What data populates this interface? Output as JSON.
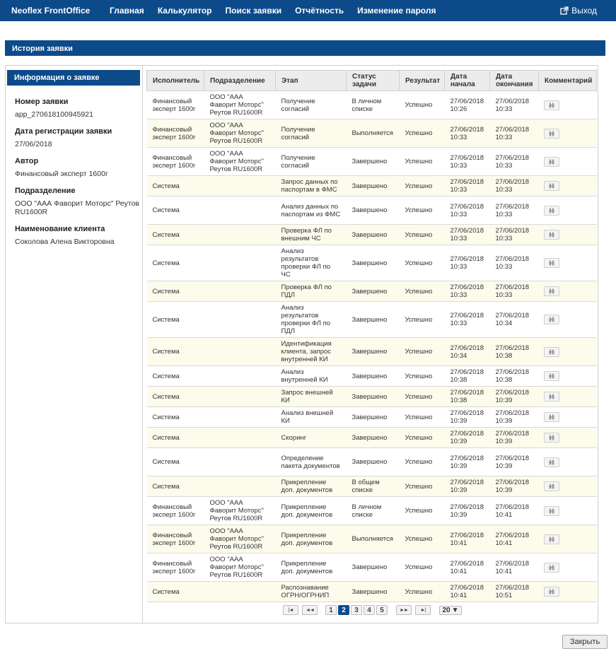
{
  "app": {
    "brand": "Neoflex FrontOffice"
  },
  "nav": {
    "items": [
      "Главная",
      "Калькулятор",
      "Поиск заявки",
      "Отчётность",
      "Изменение пароля"
    ],
    "logout_label": "Выход"
  },
  "panel": {
    "title": "История заявки"
  },
  "sidebar": {
    "title": "Информация о заявке",
    "fields": [
      {
        "label": "Номер заявки",
        "value": "app_270618100945921"
      },
      {
        "label": "Дата регистрации заявки",
        "value": "27/06/2018"
      },
      {
        "label": "Автор",
        "value": "Финансовый эксперт 1600г"
      },
      {
        "label": "Подразделение",
        "value": "ООО \"ААА Фаворит Моторс\" Реутов RU1600R"
      },
      {
        "label": "Наименование клиента",
        "value": "Соколова Алена Викторовна"
      }
    ]
  },
  "table": {
    "columns": [
      "Исполнитель",
      "Подразделение",
      "Этап",
      "Статус задачи",
      "Результат",
      "Дата начала",
      "Дата окончания",
      "Комментарий"
    ],
    "comment_icon": "binoculars-icon",
    "rows": [
      [
        "Финансовый эксперт 1600г",
        "ООО \"ААА Фаворит Моторс\" Реутов RU1600R",
        "Получение согласий",
        "В личном списке",
        "Успешно",
        "27/06/2018 10:26",
        "27/06/2018 10:33"
      ],
      [
        "Финансовый эксперт 1600г",
        "ООО \"ААА Фаворит Моторс\" Реутов RU1600R",
        "Получение согласий",
        "Выполняется",
        "Успешно",
        "27/06/2018 10:33",
        "27/06/2018 10:33"
      ],
      [
        "Финансовый эксперт 1600г",
        "ООО \"ААА Фаворит Моторс\" Реутов RU1600R",
        "Получение согласий",
        "Завершено",
        "Успешно",
        "27/06/2018 10:33",
        "27/06/2018 10:33"
      ],
      [
        "Система",
        "",
        "Запрос данных по паспортам в ФМС",
        "Завершено",
        "Успешно",
        "27/06/2018 10:33",
        "27/06/2018 10:33"
      ],
      [
        "Система",
        "",
        "Анализ данных по паспортам из ФМС",
        "Завершено",
        "Успешно",
        "27/06/2018 10:33",
        "27/06/2018 10:33"
      ],
      [
        "Система",
        "",
        "Проверка ФЛ по внешним ЧС",
        "Завершено",
        "Успешно",
        "27/06/2018 10:33",
        "27/06/2018 10:33"
      ],
      [
        "Система",
        "",
        "Анализ результатов проверки ФЛ по ЧС",
        "Завершено",
        "Успешно",
        "27/06/2018 10:33",
        "27/06/2018 10:33"
      ],
      [
        "Система",
        "",
        "Проверка ФЛ по ПДЛ",
        "Завершено",
        "Успешно",
        "27/06/2018 10:33",
        "27/06/2018 10:33"
      ],
      [
        "Система",
        "",
        "Анализ результатов проверки ФЛ по ПДЛ",
        "Завершено",
        "Успешно",
        "27/06/2018 10:33",
        "27/06/2018 10:34"
      ],
      [
        "Система",
        "",
        "Идентификация клиента, запрос внутренней КИ",
        "Завершено",
        "Успешно",
        "27/06/2018 10:34",
        "27/06/2018 10:38"
      ],
      [
        "Система",
        "",
        "Анализ внутренней КИ",
        "Завершено",
        "Успешно",
        "27/06/2018 10:38",
        "27/06/2018 10:38"
      ],
      [
        "Система",
        "",
        "Запрос внешней КИ",
        "Завершено",
        "Успешно",
        "27/06/2018 10:38",
        "27/06/2018 10:39"
      ],
      [
        "Система",
        "",
        "Анализ внешней КИ",
        "Завершено",
        "Успешно",
        "27/06/2018 10:39",
        "27/06/2018 10:39"
      ],
      [
        "Система",
        "",
        "Скоринг",
        "Завершено",
        "Успешно",
        "27/06/2018 10:39",
        "27/06/2018 10:39"
      ],
      [
        "Система",
        "",
        "Определение пакета документов",
        "Завершено",
        "Успешно",
        "27/06/2018 10:39",
        "27/06/2018 10:39"
      ],
      [
        "Система",
        "",
        "Прикрепление доп. документов",
        "В общем списке",
        "Успешно",
        "27/06/2018 10:39",
        "27/06/2018 10:39"
      ],
      [
        "Финансовый эксперт 1600г",
        "ООО \"ААА Фаворит Моторс\" Реутов RU1600R",
        "Прикрепление доп. документов",
        "В личном списке",
        "Успешно",
        "27/06/2018 10:39",
        "27/06/2018 10:41"
      ],
      [
        "Финансовый эксперт 1600г",
        "ООО \"ААА Фаворит Моторс\" Реутов RU1600R",
        "Прикрепление доп. документов",
        "Выполняется",
        "Успешно",
        "27/06/2018 10:41",
        "27/06/2018 10:41"
      ],
      [
        "Финансовый эксперт 1600г",
        "ООО \"ААА Фаворит Моторс\" Реутов RU1600R",
        "Прикрепление доп. документов",
        "Завершено",
        "Успешно",
        "27/06/2018 10:41",
        "27/06/2018 10:41"
      ],
      [
        "Система",
        "",
        "Распознавание ОГРН/ОГРНИП",
        "Завершено",
        "Успешно",
        "27/06/2018 10:41",
        "27/06/2018 10:51"
      ]
    ]
  },
  "pagination": {
    "first": "|◄",
    "prev": "◄◄",
    "pages": [
      "1",
      "2",
      "3",
      "4",
      "5"
    ],
    "current": "2",
    "next": "►►",
    "last": "►|",
    "page_size": "20"
  },
  "footer": {
    "close_label": "Закрыть"
  },
  "colors": {
    "brand_blue": "#0c4a8a",
    "row_alt": "#fcfbec"
  }
}
